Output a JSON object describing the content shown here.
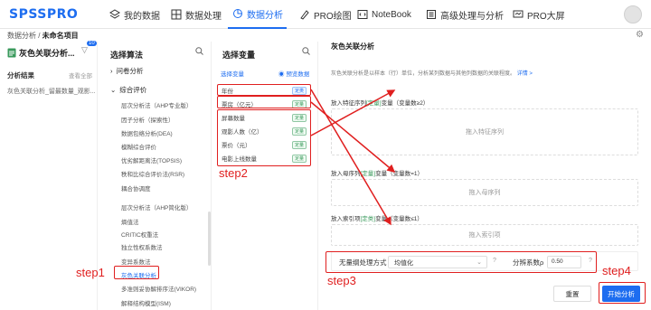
{
  "logo": "SPSSPRO",
  "nav": [
    {
      "label": "我的数据",
      "icon": "layers-icon"
    },
    {
      "label": "数据处理",
      "icon": "grid-icon"
    },
    {
      "label": "数据分析",
      "icon": "pie-chart-icon"
    },
    {
      "label": "PRO绘图",
      "icon": "brush-icon"
    },
    {
      "label": "NoteBook",
      "icon": "code-icon"
    },
    {
      "label": "高级处理与分析",
      "icon": "stack-icon"
    },
    {
      "label": "PRO大屏",
      "icon": "monitor-icon"
    }
  ],
  "breadcrumb": {
    "root": "数据分析",
    "sep": " / ",
    "current": "未命名项目"
  },
  "left": {
    "title": "灰色关联分析...",
    "filter_badge": "10",
    "results_label": "分析结果",
    "see_all": "查看全部",
    "result_item": "灰色关联分析_留最数量_观影..."
  },
  "algorithms": {
    "title": "选择算法",
    "groups": [
      {
        "label": "问卷分析"
      },
      {
        "label": "综合评价"
      }
    ],
    "items": [
      "层次分析法（AHP专业版）",
      "因子分析（探索性）",
      "数据包络分析(DEA)",
      "模糊综合评价",
      "优劣解距离法(TOPSIS)",
      "秩和比综合评价法(RSR)",
      "耦合协调度",
      "层次分析法（AHP简化版）",
      "熵值法",
      "CRITIC权重法",
      "独立性权系数法",
      "变异系数法",
      "灰色关联分析",
      "多准则妥协解排序法(VIKOR)",
      "解释结构模型(ISM)"
    ]
  },
  "variables": {
    "title": "选择变量",
    "tab": "选择变量",
    "preview": "预览数据",
    "items": [
      {
        "name": "年份",
        "tag": "定类"
      },
      {
        "name": "票房（亿元）",
        "tag": "定量"
      },
      {
        "name": "屏幕数量",
        "tag": "定量"
      },
      {
        "name": "观影人数（亿）",
        "tag": "定量"
      },
      {
        "name": "票价（元）",
        "tag": "定量"
      },
      {
        "name": "电影上线数量",
        "tag": "定量"
      }
    ]
  },
  "right": {
    "title": "灰色关联分析",
    "desc": "灰色关联分析是以样本（行）单位，分析某列数据与其他列数据的关联程度。",
    "detail": "详情 >",
    "s1": {
      "pre": "放入特征序列",
      "tag": "[定量]",
      "post": "变量（变量数≥2）",
      "placeholder": "拖入特征序列"
    },
    "s2": {
      "pre": "放入母序列",
      "tag": "[定量]",
      "post": "变量（变量数=1）",
      "placeholder": "拖入母序列"
    },
    "s3": {
      "pre": "放入索引项",
      "tag": "[定类]",
      "post": "变量（变量数≤1）",
      "placeholder": "拖入索引项"
    },
    "cfg_label": "无量纲处理方式",
    "cfg_value": "均值化",
    "rho_label": "分辨系数ρ",
    "rho_value": "0.50",
    "reset": "重置",
    "run": "开始分析"
  },
  "annotations": {
    "step1": "step1",
    "step2": "step2",
    "step3": "step3",
    "step4": "step4"
  },
  "colors": {
    "accent": "#1d6df0",
    "annotation": "#e01f1f",
    "tag_green": "#3a9a5c"
  }
}
